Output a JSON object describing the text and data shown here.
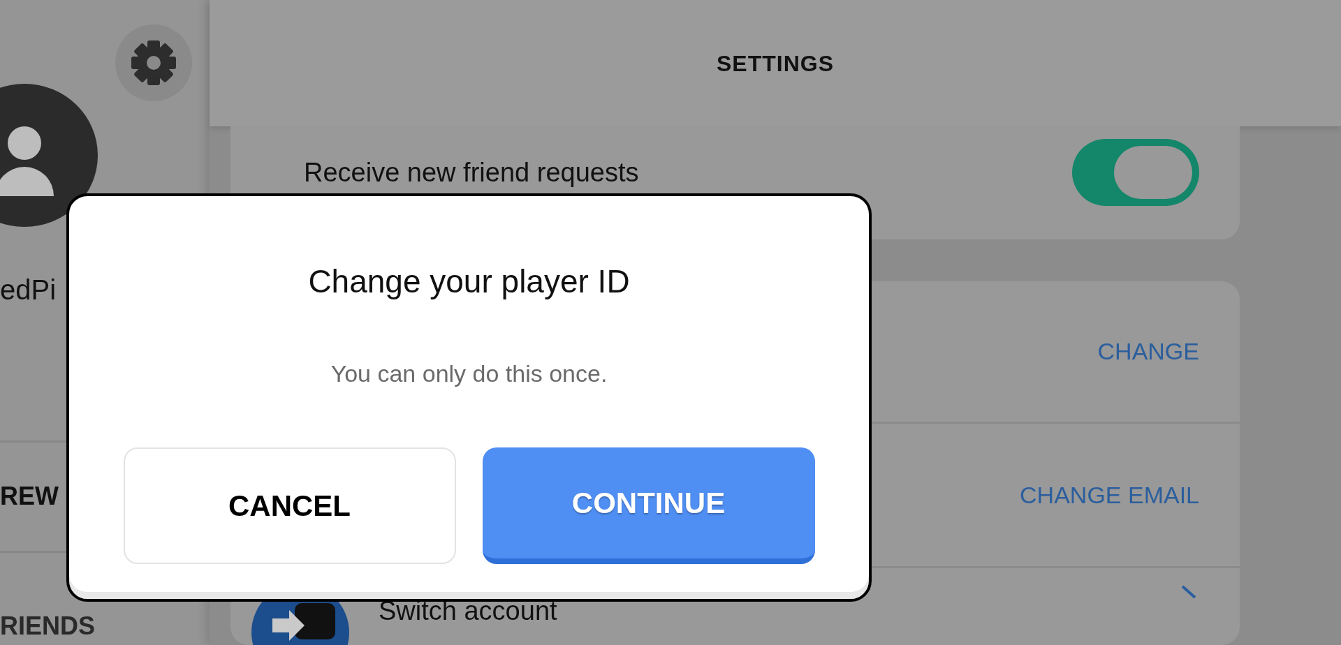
{
  "sidebar": {
    "player_name": "edPi",
    "items": [
      {
        "label": "REW"
      },
      {
        "label": "RIENDS"
      }
    ]
  },
  "header": {
    "title": "SETTINGS"
  },
  "cards": [
    {
      "rows": [
        {
          "kind": "toggle",
          "label": "Receive new friend requests",
          "on": true
        }
      ]
    },
    {
      "rows": [
        {
          "kind": "action",
          "action": "CHANGE"
        },
        {
          "kind": "action",
          "action": "CHANGE EMAIL"
        },
        {
          "kind": "link",
          "label": "Switch account"
        }
      ]
    }
  ],
  "dialog": {
    "title": "Change your player ID",
    "message": "You can only do this once.",
    "buttons": [
      {
        "label": "CANCEL",
        "kind": "secondary"
      },
      {
        "label": "CONTINUE",
        "kind": "primary"
      }
    ]
  }
}
